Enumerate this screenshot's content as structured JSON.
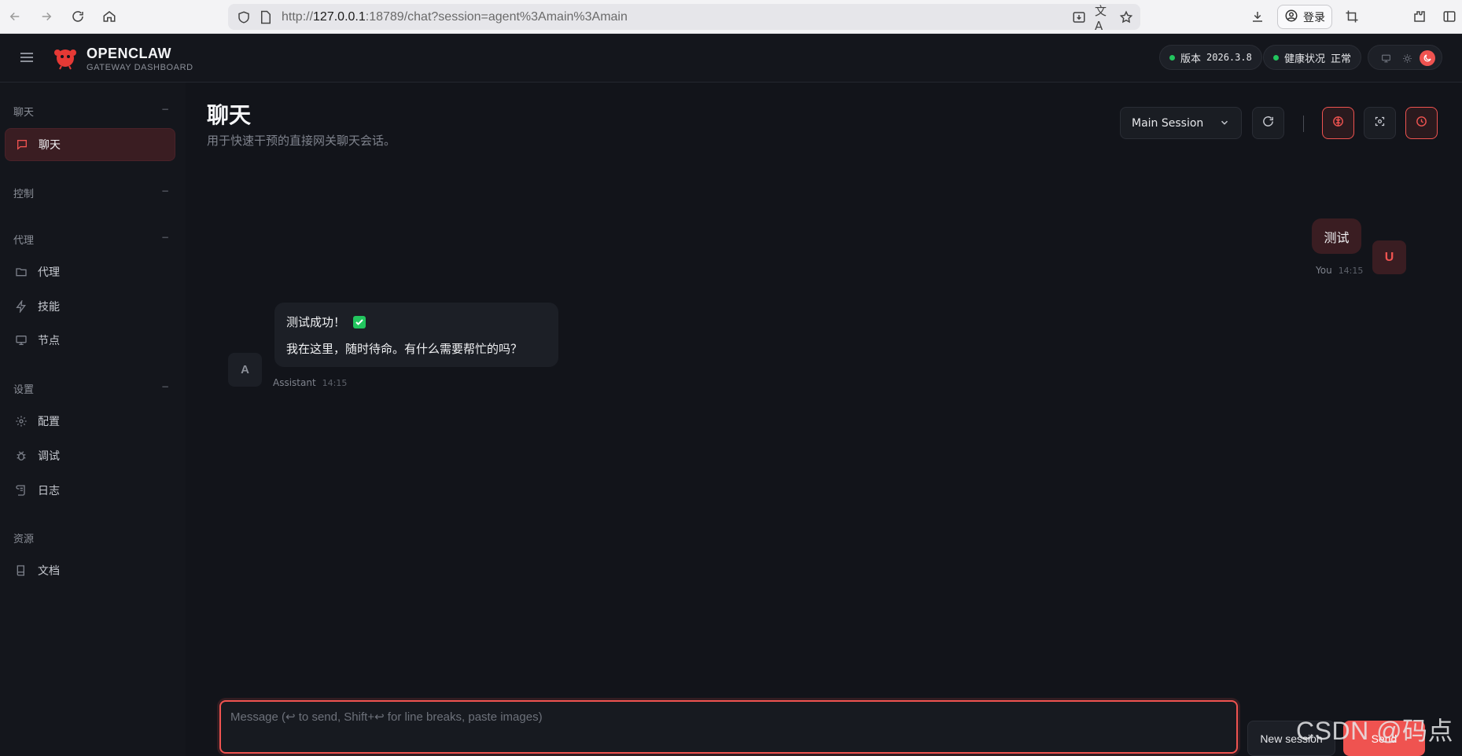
{
  "browser": {
    "url_prefix": "http://",
    "url_host": "127.0.0.1",
    "url_rest": ":18789/chat?session=agent%3Amain%3Amain",
    "login_label": "登录"
  },
  "header": {
    "brand_name": "OPENCLAW",
    "brand_sub": "GATEWAY DASHBOARD",
    "version_label": "版本",
    "version_value": "2026.3.8",
    "health_label": "健康状况",
    "health_value": "正常"
  },
  "sidebar": {
    "sections": [
      {
        "label": "聊天",
        "items": [
          {
            "label": "聊天",
            "icon": "chat-icon",
            "active": true
          }
        ]
      },
      {
        "label": "控制",
        "items": []
      },
      {
        "label": "代理",
        "items": [
          {
            "label": "代理",
            "icon": "folder-icon"
          },
          {
            "label": "技能",
            "icon": "bolt-icon"
          },
          {
            "label": "节点",
            "icon": "monitor-icon"
          }
        ]
      },
      {
        "label": "设置",
        "items": [
          {
            "label": "配置",
            "icon": "gear-icon"
          },
          {
            "label": "调试",
            "icon": "bug-icon"
          },
          {
            "label": "日志",
            "icon": "scroll-icon"
          }
        ]
      },
      {
        "label": "资源",
        "items": [
          {
            "label": "文档",
            "icon": "book-icon"
          }
        ]
      }
    ],
    "collapse_glyph": "−"
  },
  "main": {
    "title": "聊天",
    "subtitle": "用于快速干预的直接网关聊天会话。",
    "session_select": "Main Session"
  },
  "messages": [
    {
      "role": "user",
      "avatar": "U",
      "author": "You",
      "time": "14:15",
      "text": "测试"
    },
    {
      "role": "assistant",
      "avatar": "A",
      "author": "Assistant",
      "time": "14:15",
      "line1": "测试成功！",
      "line2": "我在这里，随时待命。有什么需要帮忙的吗？"
    }
  ],
  "composer": {
    "placeholder": "Message (↩ to send, Shift+↩ for line breaks, paste images)",
    "new_session_label": "New session",
    "send_label": "Send"
  },
  "watermark": "CSDN @码点",
  "colors": {
    "accent": "#ef5350",
    "background": "#12141a",
    "sidebar": "#14161c",
    "status_ok": "#22c55e"
  }
}
